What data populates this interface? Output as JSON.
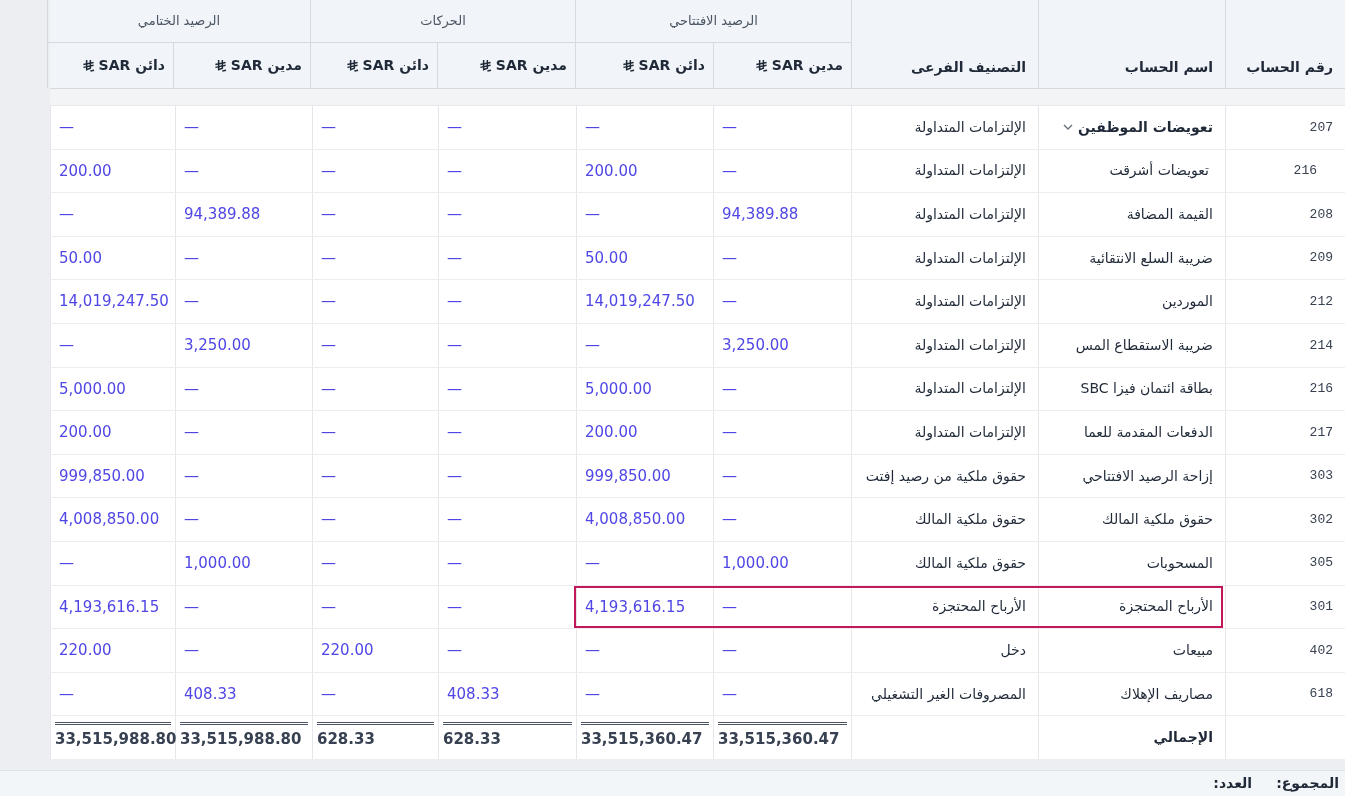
{
  "table": {
    "column_groups": [
      {
        "label": "الرصيد الافتتاحي"
      },
      {
        "label": "الحركات"
      },
      {
        "label": "الرصيد الختامي"
      }
    ],
    "columns": [
      "رقم الحساب",
      "اسم الحساب",
      "التصنيف الفرعى",
      "مدين SAR",
      "دائن SAR",
      "مدين SAR",
      "دائن SAR",
      "مدين SAR",
      "دائن SAR"
    ],
    "rows": [
      {
        "number": "207",
        "name": "تعويضات الموظفين",
        "subcategory": "الإلتزامات المتداولة",
        "values": [
          "—",
          "—",
          "—",
          "—",
          "—",
          "—"
        ],
        "expanded": true,
        "highlighted": false,
        "children": [
          {
            "number": "216",
            "name": "تعويضات أشرقت",
            "subcategory": "الإلتزامات المتداولة",
            "values": [
              "—",
              "200.00",
              "—",
              "—",
              "—",
              "200.00"
            ],
            "highlighted": false
          }
        ]
      },
      {
        "number": "208",
        "name": "القيمة المضافة",
        "subcategory": "الإلتزامات المتداولة",
        "values": [
          "94,389.88",
          "—",
          "—",
          "—",
          "94,389.88",
          "—"
        ],
        "highlighted": false
      },
      {
        "number": "209",
        "name": "ضريبة السلع الانتقائية",
        "subcategory": "الإلتزامات المتداولة",
        "values": [
          "—",
          "50.00",
          "—",
          "—",
          "—",
          "50.00"
        ],
        "highlighted": false
      },
      {
        "number": "212",
        "name": "الموردين",
        "subcategory": "الإلتزامات المتداولة",
        "values": [
          "—",
          "14,019,247.50",
          "—",
          "—",
          "—",
          "14,019,247.50"
        ],
        "highlighted": false
      },
      {
        "number": "214",
        "name": "ضريبة الاستقطاع المس",
        "subcategory": "الإلتزامات المتداولة",
        "values": [
          "3,250.00",
          "—",
          "—",
          "—",
          "3,250.00",
          "—"
        ],
        "highlighted": false
      },
      {
        "number": "216",
        "name": "بطاقة ائتمان فيزا SBC",
        "subcategory": "الإلتزامات المتداولة",
        "values": [
          "—",
          "5,000.00",
          "—",
          "—",
          "—",
          "5,000.00"
        ],
        "highlighted": false
      },
      {
        "number": "217",
        "name": "الدفعات المقدمة للعما",
        "subcategory": "الإلتزامات المتداولة",
        "values": [
          "—",
          "200.00",
          "—",
          "—",
          "—",
          "200.00"
        ],
        "highlighted": false
      },
      {
        "number": "303",
        "name": "إزاحة الرصيد الافتتاحي",
        "subcategory": "حقوق ملكية من رصيد إفتت",
        "values": [
          "—",
          "999,850.00",
          "—",
          "—",
          "—",
          "999,850.00"
        ],
        "highlighted": false
      },
      {
        "number": "302",
        "name": "حقوق ملكية المالك",
        "subcategory": "حقوق ملكية المالك",
        "values": [
          "—",
          "4,008,850.00",
          "—",
          "—",
          "—",
          "4,008,850.00"
        ],
        "highlighted": false
      },
      {
        "number": "305",
        "name": "المسحوبات",
        "subcategory": "حقوق ملكية المالك",
        "values": [
          "1,000.00",
          "—",
          "—",
          "—",
          "1,000.00",
          "—"
        ],
        "highlighted": false
      },
      {
        "number": "301",
        "name": "الأرباح المحتجزة",
        "subcategory": "الأرباح المحتجزة",
        "values": [
          "—",
          "4,193,616.15",
          "—",
          "—",
          "—",
          "4,193,616.15"
        ],
        "highlighted": true
      },
      {
        "number": "402",
        "name": "مبيعات",
        "subcategory": "دخل",
        "values": [
          "—",
          "—",
          "—",
          "220.00",
          "—",
          "220.00"
        ],
        "highlighted": false
      },
      {
        "number": "618",
        "name": "مصاريف الإهلاك",
        "subcategory": "المصروفات الغير التشغيلي",
        "values": [
          "—",
          "—",
          "408.33",
          "—",
          "408.33",
          "—"
        ],
        "highlighted": false
      }
    ],
    "total": {
      "label": "الإجمالي",
      "values": [
        "33,515,360.47",
        "33,515,360.47",
        "628.33",
        "628.33",
        "33,515,988.80",
        "33,515,988.80"
      ]
    }
  },
  "footer": {
    "sum_label": "المجموع:",
    "count_label": "العدد:"
  }
}
